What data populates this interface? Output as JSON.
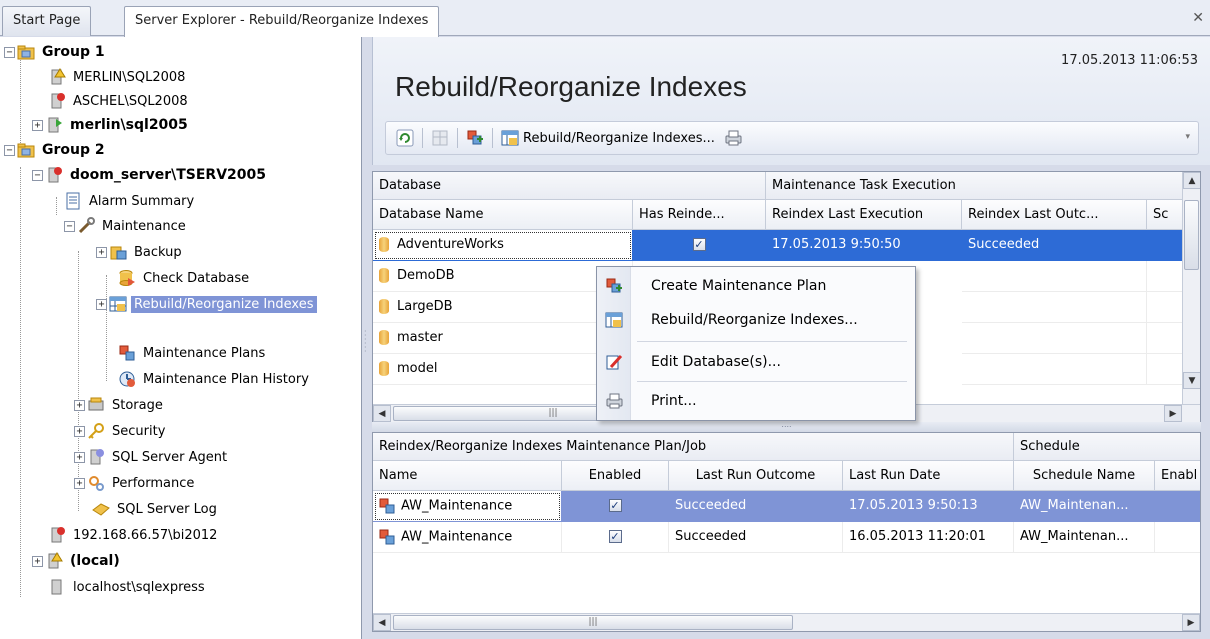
{
  "tabs": [
    {
      "label": "Start Page"
    },
    {
      "label": "Server Explorer - Rebuild/Reorganize Indexes"
    }
  ],
  "tree": {
    "items": [
      {
        "label": "Group 1"
      },
      {
        "label": "MERLIN\\SQL2008"
      },
      {
        "label": "ASCHEL\\SQL2008"
      },
      {
        "label": "merlin\\sql2005"
      },
      {
        "label": "Group 2"
      },
      {
        "label": "doom_server\\TSERV2005"
      },
      {
        "label": "Alarm Summary"
      },
      {
        "label": "Maintenance"
      },
      {
        "label": "Backup"
      },
      {
        "label": "Check Database"
      },
      {
        "label": "Rebuild/Reorganize Indexes"
      },
      {
        "label": "Maintenance Plans"
      },
      {
        "label": "Maintenance Plan History"
      },
      {
        "label": "Storage"
      },
      {
        "label": "Security"
      },
      {
        "label": "SQL Server Agent"
      },
      {
        "label": "Performance"
      },
      {
        "label": "SQL Server Log"
      },
      {
        "label": "192.168.66.57\\bi2012"
      },
      {
        "label": "(local)"
      },
      {
        "label": "localhost\\sqlexpress"
      }
    ]
  },
  "header": {
    "title": "Rebuild/Reorganize Indexes",
    "timestamp": "17.05.2013 11:06:53"
  },
  "toolbar": {
    "rebuild_label": "Rebuild/Reorganize Indexes..."
  },
  "db_grid": {
    "bands": [
      "Database",
      "Maintenance Task Execution"
    ],
    "columns": [
      "Database Name",
      "Has Reinde...",
      "Reindex Last Execution",
      "Reindex Last Outc...",
      "Sc"
    ],
    "rows": [
      {
        "name": "AdventureWorks",
        "has_reindex": "✓",
        "last_exec": "17.05.2013 9:50:50",
        "outcome": "Succeeded"
      },
      {
        "name": "DemoDB"
      },
      {
        "name": "LargeDB"
      },
      {
        "name": "master"
      },
      {
        "name": "model"
      }
    ]
  },
  "context_menu": {
    "items": [
      {
        "label": "Create Maintenance Plan"
      },
      {
        "label": "Rebuild/Reorganize Indexes..."
      },
      {
        "label": "Edit Database(s)..."
      },
      {
        "label": "Print..."
      }
    ]
  },
  "plan_grid": {
    "bands": [
      "Reindex/Reorganize Indexes Maintenance Plan/Job",
      "Schedule"
    ],
    "columns": [
      "Name",
      "Enabled",
      "Last Run Outcome",
      "Last Run Date",
      "Schedule Name",
      "Enabl"
    ],
    "rows": [
      {
        "name": "AW_Maintenance",
        "enabled": "✓",
        "outcome": "Succeeded",
        "date": "17.05.2013 9:50:13",
        "schedule": "AW_Maintenan..."
      },
      {
        "name": "AW_Maintenance",
        "enabled": "✓",
        "outcome": "Succeeded",
        "date": "16.05.2013 11:20:01",
        "schedule": "AW_Maintenan..."
      }
    ]
  },
  "colors": {
    "selection": "#2d6bd6",
    "tree_selection": "#7f94d6",
    "panel_bg": "#d6dbe9"
  }
}
